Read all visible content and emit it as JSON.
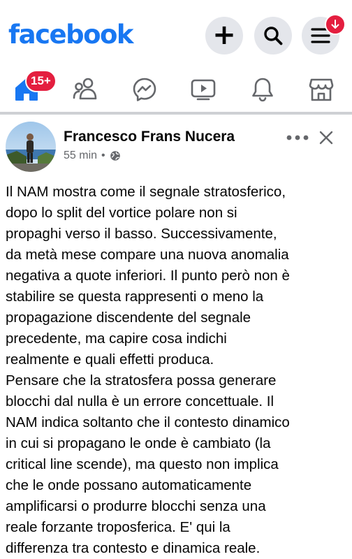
{
  "header": {
    "logo": "facebook",
    "notification_dot_icon": "arrow-down-icon",
    "colors": {
      "brand": "#1877f2",
      "badge": "#e41e3f",
      "button_bg": "#e4e6eb"
    }
  },
  "tabs": {
    "items": [
      {
        "name": "home",
        "icon": "home-icon",
        "active": true
      },
      {
        "name": "friends",
        "icon": "friends-icon"
      },
      {
        "name": "messenger",
        "icon": "messenger-icon"
      },
      {
        "name": "video",
        "icon": "video-icon"
      },
      {
        "name": "notifications",
        "icon": "bell-icon"
      },
      {
        "name": "marketplace",
        "icon": "marketplace-icon"
      }
    ],
    "home_badge": "15+"
  },
  "post": {
    "author": "Francesco Frans Nucera",
    "time": "55 min",
    "separator": "•",
    "privacy_icon": "globe-icon",
    "more_label": "•••",
    "lines": [
      "Il NAM mostra come il segnale stratosferico,",
      "dopo lo split del vortice polare non si",
      "propaghi verso il basso. Successivamente,",
      "da metà mese compare una nuova anomalia",
      "negativa a quote inferiori. Il punto però non è",
      "stabilire se questa rappresenti o meno la",
      "propagazione discendente del segnale",
      "precedente, ma capire cosa indichi",
      "realmente e quali effetti produca.",
      "Pensare che la stratosfera possa generare",
      "blocchi dal nulla è un errore concettuale. Il",
      "NAM indica soltanto che il contesto dinamico",
      "in cui si propagano le onde è cambiato (la",
      "critical line scende), ma questo non implica",
      "che le onde possano automaticamente",
      "amplificarsi o produrre blocchi senza una",
      "reale forzante troposferica. E' qui la",
      "differenza tra contesto e dinamica reale."
    ]
  }
}
